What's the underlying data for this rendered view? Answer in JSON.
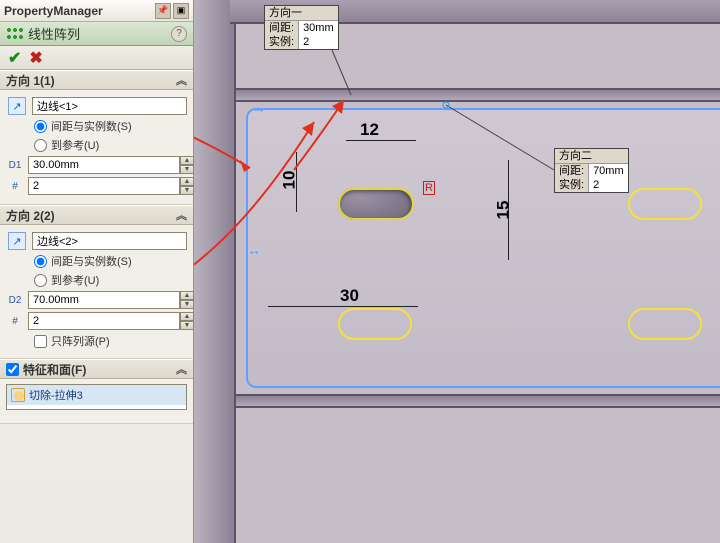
{
  "pm": {
    "title": "PropertyManager",
    "feature_title": "线性阵列",
    "ok": "✔",
    "cancel": "✖"
  },
  "dir1": {
    "header": "方向 1(1)",
    "edge_label": "边线<1>",
    "opt_spacing": "间距与实例数(S)",
    "opt_ref": "到参考(U)",
    "spacing": "30.00mm",
    "count": "2"
  },
  "dir2": {
    "header": "方向 2(2)",
    "edge_label": "边线<2>",
    "opt_spacing": "间距与实例数(S)",
    "opt_ref": "到参考(U)",
    "spacing": "70.00mm",
    "count": "2",
    "only_seed": "只阵列源(P)"
  },
  "features": {
    "header": "特征和面(F)",
    "item": "切除-拉伸3"
  },
  "callout1": {
    "title": "方向一",
    "spacing_k": "间距:",
    "spacing_v": "30mm",
    "inst_k": "实例:",
    "inst_v": "2"
  },
  "callout2": {
    "title": "方向二",
    "spacing_k": "间距:",
    "spacing_v": "70mm",
    "inst_k": "实例:",
    "inst_v": "2"
  },
  "dims": {
    "d12": "12",
    "d10": "10",
    "d15": "15",
    "d30": "30",
    "rphi": "R/ø"
  },
  "icons": {
    "d1": "D1",
    "d2": "D2",
    "count": "#"
  }
}
